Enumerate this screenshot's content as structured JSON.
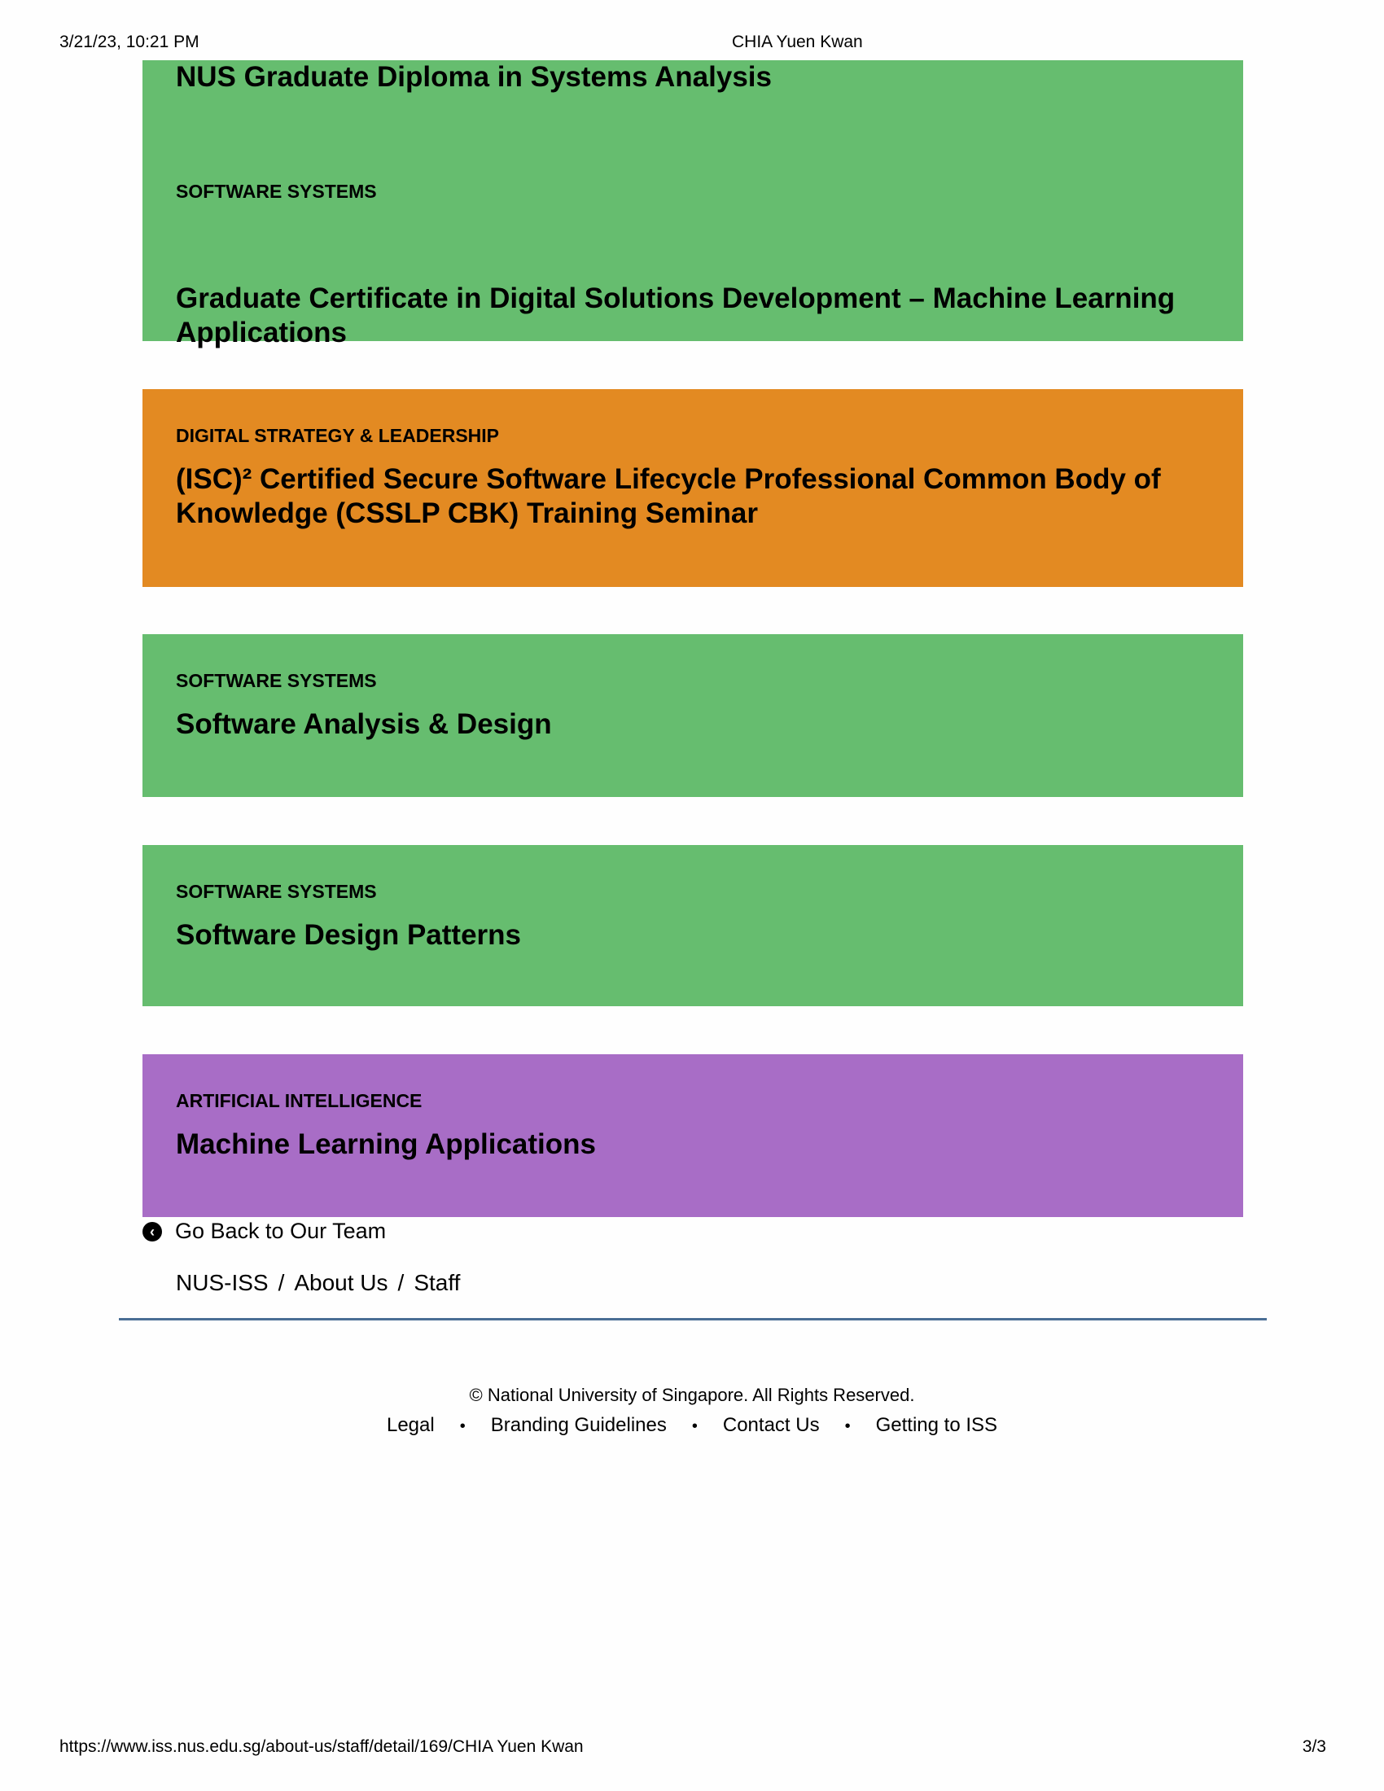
{
  "print_header": {
    "datetime": "3/21/23, 10:21 PM",
    "title": "CHIA Yuen Kwan"
  },
  "courses": [
    {
      "partial_title": "NUS Graduate Diploma in Systems Analysis",
      "category": "SOFTWARE SYSTEMS",
      "title": "Graduate Certificate in Digital Solutions Development – Machine Learning Applications",
      "color": "#66bd6f"
    },
    {
      "category": "DIGITAL STRATEGY & LEADERSHIP",
      "title": "(ISC)² Certified Secure Software Lifecycle Professional Common Body of Knowledge (CSSLP CBK) Training Seminar",
      "color": "#e38a22"
    },
    {
      "category": "SOFTWARE SYSTEMS",
      "title": "Software Analysis & Design",
      "color": "#66bd6f"
    },
    {
      "category": "SOFTWARE SYSTEMS",
      "title": "Software Design Patterns",
      "color": "#66bd6f"
    },
    {
      "category": "ARTIFICIAL INTELLIGENCE",
      "title": "Machine Learning Applications",
      "color": "#a86dc6"
    }
  ],
  "back_link": {
    "label": "Go Back to Our Team",
    "icon": "chevron-left-circle-icon"
  },
  "breadcrumb": {
    "items": [
      "NUS-ISS",
      "About Us",
      "Staff"
    ],
    "separator": "/"
  },
  "footer": {
    "copyright": "© National University of Singapore. All Rights Reserved.",
    "links": [
      "Legal",
      "Branding Guidelines",
      "Contact Us",
      "Getting to ISS"
    ],
    "separator": "•"
  },
  "print_footer": {
    "url": "https://www.iss.nus.edu.sg/about-us/staff/detail/169/CHIA Yuen Kwan",
    "page": "3/3"
  }
}
